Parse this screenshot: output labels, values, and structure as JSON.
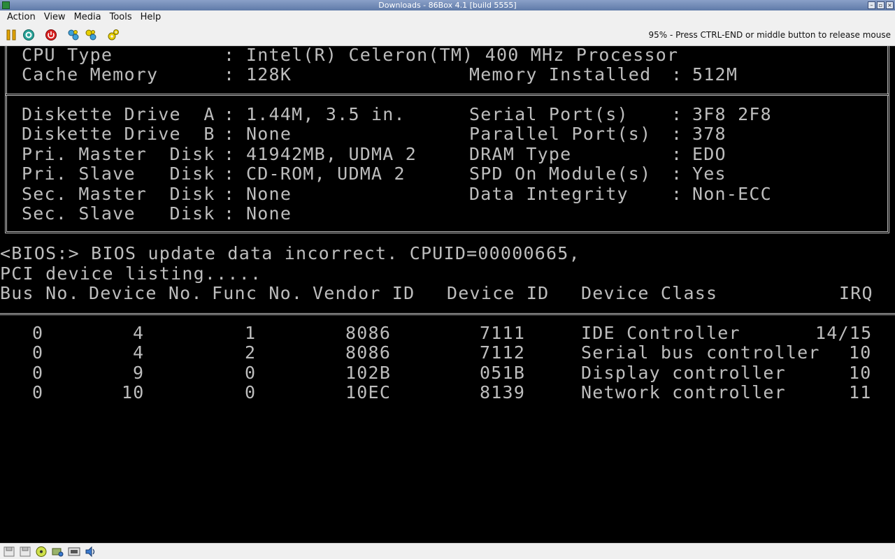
{
  "window": {
    "title": "Downloads - 86Box 4.1 [build 5555]"
  },
  "menu": [
    "Action",
    "View",
    "Media",
    "Tools",
    "Help"
  ],
  "toolbar": {
    "buttons": [
      "pause-icon",
      "reset-icon",
      "power-icon",
      "ctrl-alt-del-icon",
      "ctrl-alt-esc-icon",
      "settings-icon"
    ],
    "status": "95% - Press CTRL-END or middle button to release mouse"
  },
  "bios": {
    "cpu_label": "CPU Type",
    "cpu_value": "Intel(R) Celeron(TM) 400 MHz Processor",
    "cache_label": "Cache Memory",
    "cache_value": "128K",
    "mem_label": "Memory Installed",
    "mem_value": "512M",
    "left": [
      {
        "label": "Diskette Drive  A",
        "value": "1.44M, 3.5 in."
      },
      {
        "label": "Diskette Drive  B",
        "value": "None"
      },
      {
        "label": "Pri. Master  Disk",
        "value": "41942MB, UDMA 2"
      },
      {
        "label": "Pri. Slave   Disk",
        "value": "CD-ROM, UDMA 2"
      },
      {
        "label": "Sec. Master  Disk",
        "value": "None"
      },
      {
        "label": "Sec. Slave   Disk",
        "value": "None"
      }
    ],
    "right": [
      {
        "label": "Serial Port(s)",
        "value": "3F8 2F8"
      },
      {
        "label": "Parallel Port(s)",
        "value": "378"
      },
      {
        "label": "DRAM Type",
        "value": "EDO"
      },
      {
        "label": "SPD On Module(s)",
        "value": "Yes"
      },
      {
        "label": "Data Integrity",
        "value": "Non-ECC"
      }
    ],
    "update_msg": "<BIOS:> BIOS update data incorrect. CPUID=00000665,",
    "pci_title": "PCI device listing.....",
    "pci_headers": [
      "Bus No.",
      "Device No.",
      "Func No.",
      "Vendor ID",
      "Device ID",
      "Device Class",
      "IRQ"
    ],
    "pci_rows": [
      [
        "0",
        "4",
        "1",
        "8086",
        "7111",
        "IDE Controller",
        "14/15"
      ],
      [
        "0",
        "4",
        "2",
        "8086",
        "7112",
        "Serial bus controller",
        "10"
      ],
      [
        "0",
        "9",
        "0",
        "102B",
        "051B",
        "Display controller",
        "10"
      ],
      [
        "0",
        "10",
        "0",
        "10EC",
        "8139",
        "Network controller",
        "11"
      ]
    ]
  },
  "statusbar": {
    "icons": [
      "floppy-a-icon",
      "floppy-b-icon",
      "cdrom-icon",
      "hard-disk-icon",
      "network-icon",
      "sound-icon"
    ]
  }
}
